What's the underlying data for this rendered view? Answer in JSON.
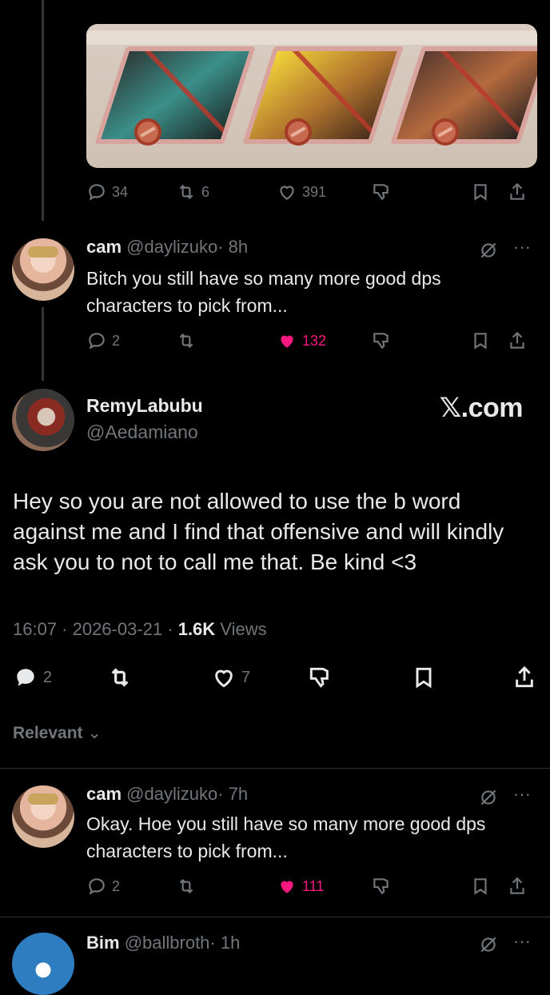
{
  "post0": {
    "actions": {
      "replies": "34",
      "reposts": "6",
      "likes": "391"
    }
  },
  "reply1": {
    "display_name": "cam",
    "handle": "@daylizuko",
    "time": "· 8h",
    "text": "Bitch you still have so many more good dps characters to pick from...",
    "actions": {
      "replies": "2",
      "reposts": "",
      "likes": "132"
    }
  },
  "main": {
    "display_name": "RemyLabubu",
    "handle": "@Aedamiano",
    "brand": "𝕏.com",
    "text": "Hey so you are not allowed to use the b word against me and I find that offensive and will kindly ask you to not to call me that. Be kind <3",
    "meta_time": "16:07 · 2026-03-21 · ",
    "views_count": "1.6K",
    "views_label": " Views",
    "actions": {
      "replies": "2",
      "reposts": "",
      "likes": "7"
    }
  },
  "sort": {
    "label": "Relevant",
    "icon": "chevron-down-icon"
  },
  "reply2": {
    "display_name": "cam",
    "handle": "@daylizuko",
    "time": "· 7h",
    "text": "Okay. Hoe you still have so many more good dps characters to pick from...",
    "actions": {
      "replies": "2",
      "reposts": "",
      "likes": "111"
    }
  },
  "reply3": {
    "display_name": "Bim",
    "handle": "@ballbroth",
    "time": "· 1h"
  },
  "colors": {
    "background": "#000000",
    "text": "#e7e9ea",
    "muted": "#71767b",
    "like_active": "#f91880",
    "divider": "#2f3336"
  }
}
